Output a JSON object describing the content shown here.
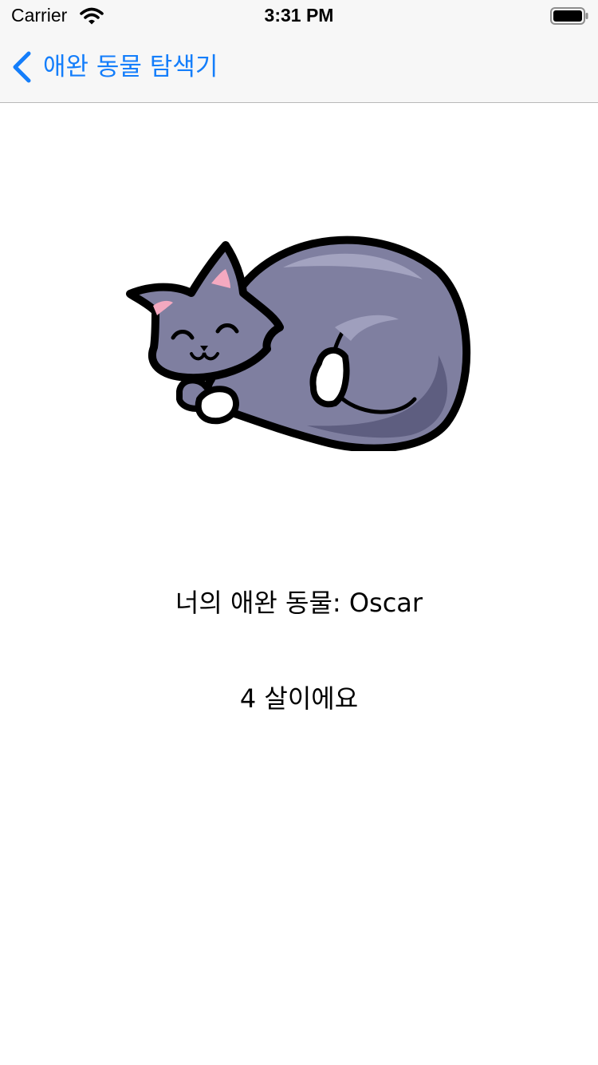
{
  "status_bar": {
    "carrier": "Carrier",
    "time": "3:31 PM",
    "wifi_icon": "wifi-icon",
    "battery_icon": "battery-icon"
  },
  "nav": {
    "back_label": "애완 동물 탐색기",
    "back_icon": "chevron-left-icon",
    "accent_color": "#147efb"
  },
  "pet": {
    "image_icon": "sleeping-cat-illustration",
    "name_line": "너의 애완 동물: Oscar",
    "age_line": "4 살이에요"
  }
}
